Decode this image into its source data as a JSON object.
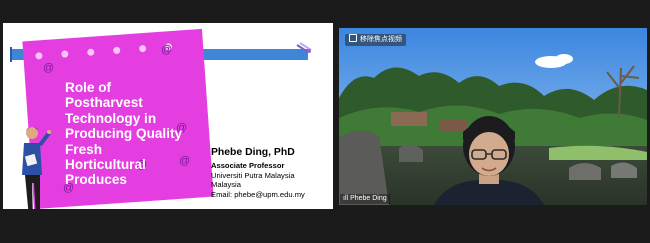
{
  "slide": {
    "title_lines": [
      "Role of",
      "Postharvest",
      "Technology in",
      "Producing Quality",
      "Fresh",
      "Horticultural",
      "Produces"
    ],
    "presenter": {
      "name": "Phebe Ding, PhD",
      "position": "Associate Professor",
      "institution": "Universiti Putra Malaysia",
      "country": "Malaysia",
      "email": "Email: phebe@upm.edu.my"
    },
    "colors": {
      "note": "#e43ee0",
      "stripe": "#3f86d8"
    }
  },
  "video": {
    "label": "移除焦点视频",
    "participant": "Phebe Ding"
  }
}
